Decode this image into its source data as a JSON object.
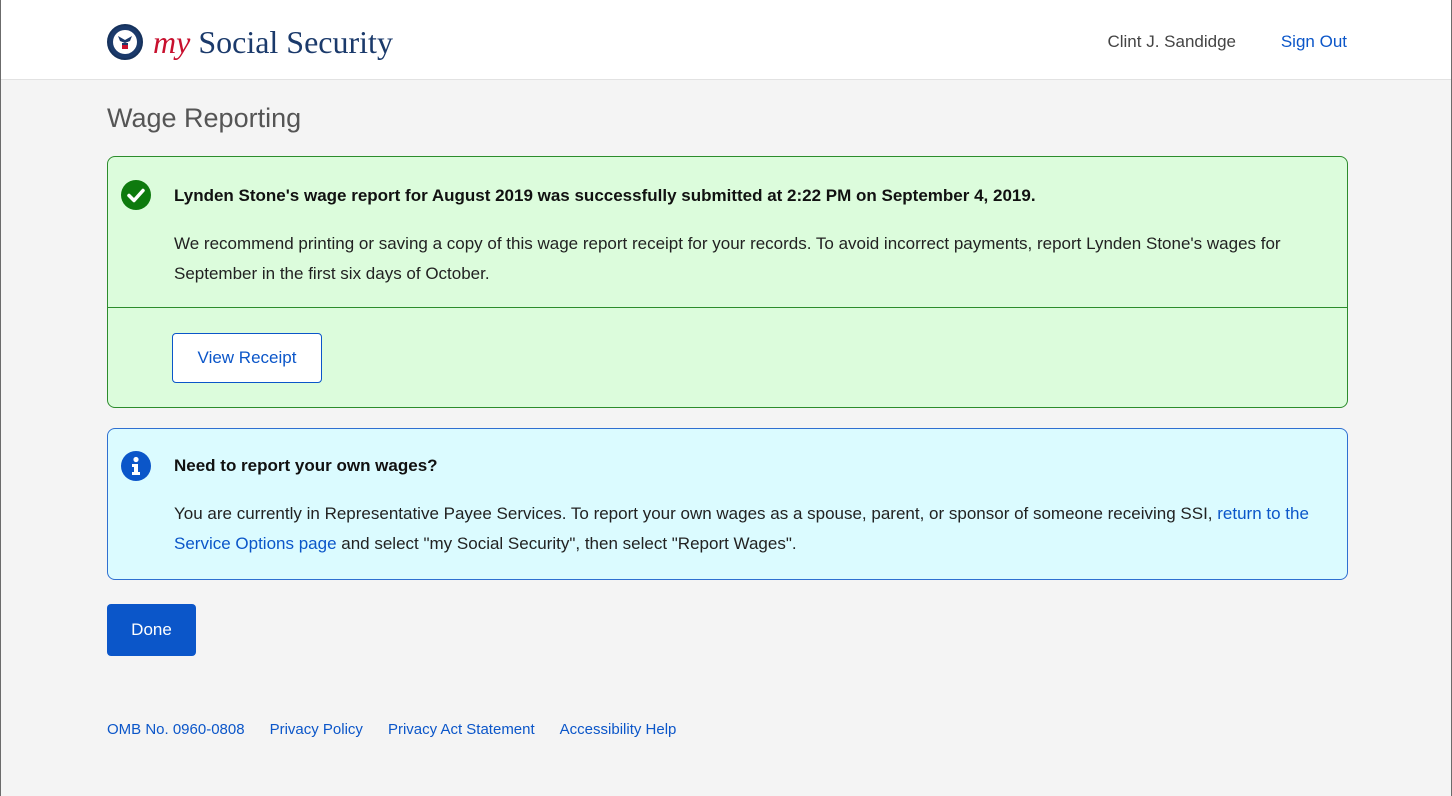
{
  "header": {
    "logo_my": "my",
    "logo_rest": " Social Security",
    "user_name": "Clint J. Sandidge",
    "sign_out": "Sign Out"
  },
  "page_title": "Wage Reporting",
  "success_alert": {
    "title": "Lynden Stone's wage report for August 2019 was successfully submitted at 2:22 PM on September 4, 2019.",
    "body": "We recommend printing or saving a copy of this wage report receipt for your records. To avoid incorrect payments, report Lynden Stone's wages for September in the first six days of October.",
    "button": "View Receipt",
    "color": "#0e7a0e"
  },
  "info_alert": {
    "title": "Need to report your own wages?",
    "body_before": "You are currently in Representative Payee Services. To report your own wages as a spouse, parent, or sponsor of someone receiving SSI, ",
    "link": "return to the Service Options page",
    "body_after": " and select \"my Social Security\", then select \"Report Wages\".",
    "color": "#0b56c9"
  },
  "done_button": "Done",
  "footer": {
    "links": [
      "OMB No. 0960-0808",
      "Privacy Policy",
      "Privacy Act Statement",
      "Accessibility Help"
    ]
  },
  "icons": {
    "seal": "ssa-seal-icon",
    "success": "check-circle-icon",
    "info": "info-circle-icon"
  }
}
